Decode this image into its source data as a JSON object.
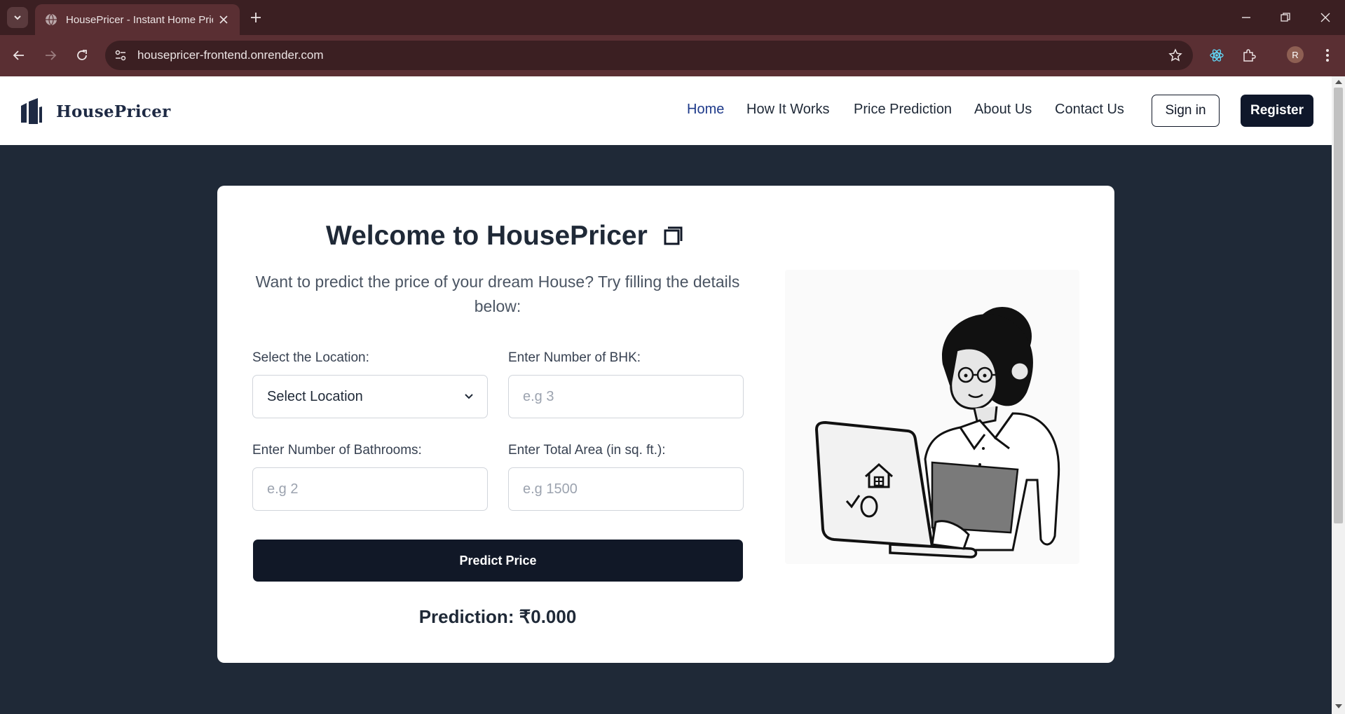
{
  "browser": {
    "tab_title": "HousePricer - Instant Home Price",
    "url": "housepricer-frontend.onrender.com",
    "profile_initial": "R"
  },
  "site": {
    "logo_text": "HousePricer",
    "nav": [
      "Home",
      "How It Works",
      "Price Prediction",
      "About Us",
      "Contact Us"
    ],
    "active_nav": "Home",
    "signin_label": "Sign in",
    "register_label": "Register"
  },
  "form": {
    "heading": "Welcome to HousePricer",
    "subtitle": "Want to predict the price of your dream House? Try filling the details below:",
    "location": {
      "label": "Select the Location:",
      "value": "Select Location"
    },
    "bhk": {
      "label": "Enter Number of BHK:",
      "placeholder": "e.g 3"
    },
    "bathrooms": {
      "label": "Enter Number of Bathrooms:",
      "placeholder": "e.g 2"
    },
    "area": {
      "label": "Enter Total Area (in sq. ft.):",
      "placeholder": "e.g 1500"
    },
    "predict_label": "Predict Price",
    "prediction_text": "Prediction: ₹0.000"
  },
  "colors": {
    "page_bg": "#1f2937",
    "primary_dark": "#111827",
    "chrome": "#5a2f33",
    "active_nav": "#1e3a8a"
  },
  "icons": [
    "tab-search-icon",
    "globe-icon",
    "close-icon",
    "plus-icon",
    "minimize-icon",
    "restore-icon",
    "back-icon",
    "forward-icon",
    "reload-icon",
    "site-info-icon",
    "star-icon",
    "react-devtools-icon",
    "extensions-icon",
    "more-menu-icon",
    "logo-icon",
    "window-icon",
    "chevron-down-icon"
  ]
}
